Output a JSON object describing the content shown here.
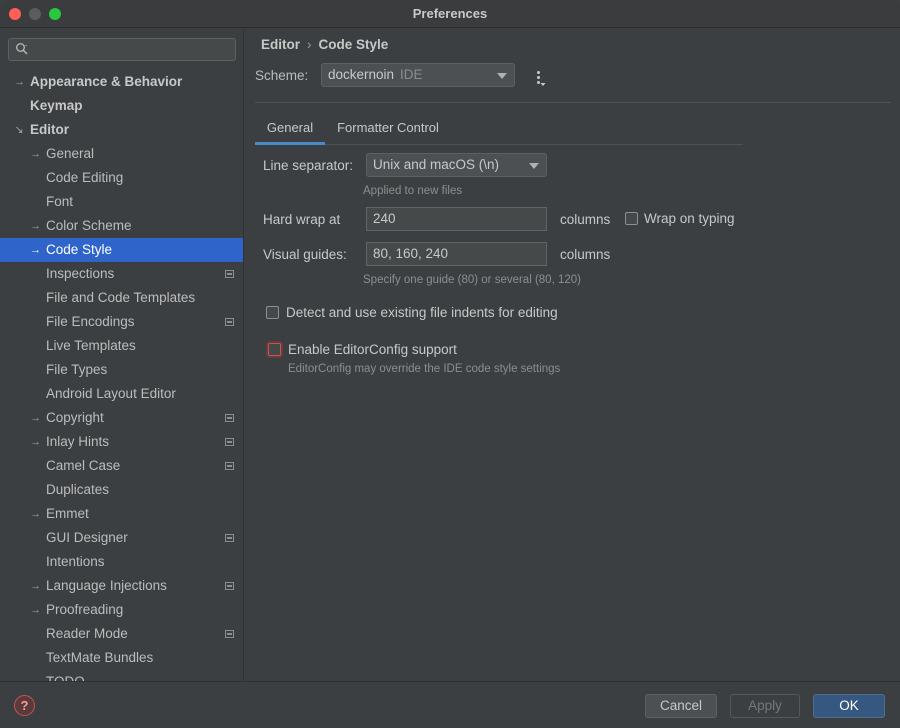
{
  "window": {
    "title": "Preferences"
  },
  "search": {
    "placeholder": "",
    "icon": "search-icon"
  },
  "sidebar": {
    "items": [
      {
        "label": "Appearance & Behavior",
        "level": 0,
        "arrow": "→",
        "bold": true,
        "project": false
      },
      {
        "label": "Keymap",
        "level": 0,
        "arrow": "",
        "bold": true,
        "project": false
      },
      {
        "label": "Editor",
        "level": 0,
        "arrow": "↘",
        "bold": true,
        "project": false
      },
      {
        "label": "General",
        "level": 1,
        "arrow": "→",
        "bold": false,
        "project": false
      },
      {
        "label": "Code Editing",
        "level": 1,
        "arrow": "",
        "bold": false,
        "project": false
      },
      {
        "label": "Font",
        "level": 1,
        "arrow": "",
        "bold": false,
        "project": false
      },
      {
        "label": "Color Scheme",
        "level": 1,
        "arrow": "→",
        "bold": false,
        "project": false
      },
      {
        "label": "Code Style",
        "level": 1,
        "arrow": "→",
        "bold": false,
        "project": false,
        "selected": true
      },
      {
        "label": "Inspections",
        "level": 1,
        "arrow": "",
        "bold": false,
        "project": true
      },
      {
        "label": "File and Code Templates",
        "level": 1,
        "arrow": "",
        "bold": false,
        "project": false
      },
      {
        "label": "File Encodings",
        "level": 1,
        "arrow": "",
        "bold": false,
        "project": true
      },
      {
        "label": "Live Templates",
        "level": 1,
        "arrow": "",
        "bold": false,
        "project": false
      },
      {
        "label": "File Types",
        "level": 1,
        "arrow": "",
        "bold": false,
        "project": false
      },
      {
        "label": "Android Layout Editor",
        "level": 1,
        "arrow": "",
        "bold": false,
        "project": false
      },
      {
        "label": "Copyright",
        "level": 1,
        "arrow": "→",
        "bold": false,
        "project": true
      },
      {
        "label": "Inlay Hints",
        "level": 1,
        "arrow": "→",
        "bold": false,
        "project": true
      },
      {
        "label": "Camel Case",
        "level": 1,
        "arrow": "",
        "bold": false,
        "project": true
      },
      {
        "label": "Duplicates",
        "level": 1,
        "arrow": "",
        "bold": false,
        "project": false
      },
      {
        "label": "Emmet",
        "level": 1,
        "arrow": "→",
        "bold": false,
        "project": false
      },
      {
        "label": "GUI Designer",
        "level": 1,
        "arrow": "",
        "bold": false,
        "project": true
      },
      {
        "label": "Intentions",
        "level": 1,
        "arrow": "",
        "bold": false,
        "project": false
      },
      {
        "label": "Language Injections",
        "level": 1,
        "arrow": "→",
        "bold": false,
        "project": true
      },
      {
        "label": "Proofreading",
        "level": 1,
        "arrow": "→",
        "bold": false,
        "project": false
      },
      {
        "label": "Reader Mode",
        "level": 1,
        "arrow": "",
        "bold": false,
        "project": true
      },
      {
        "label": "TextMate Bundles",
        "level": 1,
        "arrow": "",
        "bold": false,
        "project": false
      },
      {
        "label": "TODO",
        "level": 1,
        "arrow": "",
        "bold": false,
        "project": false
      }
    ]
  },
  "breadcrumb": {
    "parent": "Editor",
    "separator": "›",
    "current": "Code Style"
  },
  "scheme": {
    "label": "Scheme:",
    "value": "dockernoin",
    "tag": "IDE"
  },
  "tabs": [
    {
      "label": "General",
      "active": true
    },
    {
      "label": "Formatter Control",
      "active": false
    }
  ],
  "general": {
    "line_separator": {
      "label": "Line separator:",
      "value": "Unix and macOS (\\n)",
      "hint": "Applied to new files"
    },
    "hard_wrap": {
      "label": "Hard wrap at",
      "value": "240",
      "unit": "columns"
    },
    "wrap_on_typing": {
      "label": "Wrap on typing",
      "checked": false
    },
    "visual_guides": {
      "label": "Visual guides:",
      "value": "80, 160, 240",
      "unit": "columns",
      "hint": "Specify one guide (80) or several (80, 120)"
    },
    "detect_indents": {
      "label": "Detect and use existing file indents for editing",
      "checked": false
    },
    "editorconfig": {
      "label": "Enable EditorConfig support",
      "checked": false,
      "hint": "EditorConfig may override the IDE code style settings"
    }
  },
  "footer": {
    "help_label": "?",
    "cancel_label": "Cancel",
    "apply_label": "Apply",
    "ok_label": "OK"
  },
  "colors": {
    "selection": "#2f65ca",
    "primary_button": "#365880",
    "tab_underline": "#4a88c7",
    "focus_error": "#c75450"
  }
}
